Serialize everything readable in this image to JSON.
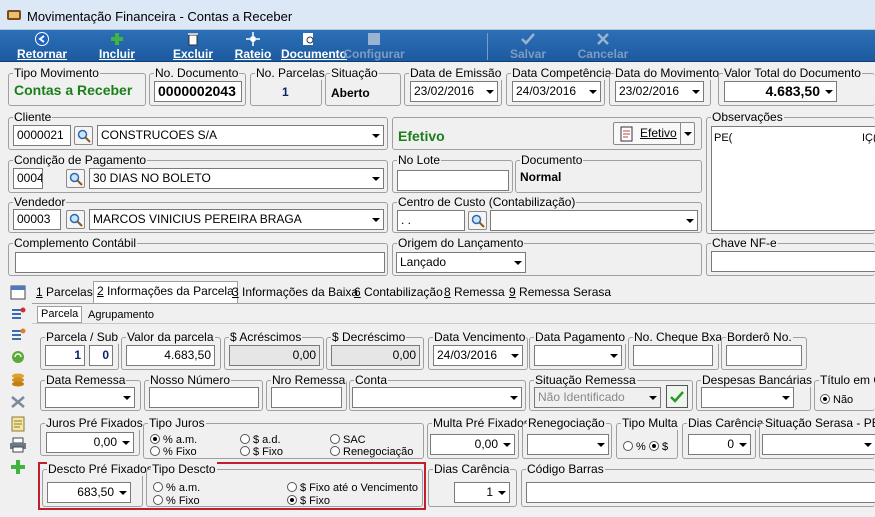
{
  "window": {
    "title": "Movimentação Financeira - Contas a Receber"
  },
  "toolbar": {
    "retornar": "Retornar",
    "incluir": "Incluir",
    "excluir": "Excluir",
    "rateio": "Rateio",
    "documento": "Documento",
    "configurar": "Configurar",
    "salvar": "Salvar",
    "cancelar": "Cancelar"
  },
  "header": {
    "tipo_movimento_label": "Tipo Movimento",
    "tipo_movimento": "Contas a Receber",
    "no_documento_label": "No. Documento",
    "no_documento": "0000002043",
    "no_parcelas_label": "No. Parcelas",
    "no_parcelas": "1",
    "situacao_label": "Situação",
    "situacao": "Aberto",
    "data_emissao_label": "Data de Emissão",
    "data_emissao": "23/02/2016",
    "data_competencia_label": "Data Competência",
    "data_competencia": "24/03/2016",
    "data_movimento_label": "Data do Movimento",
    "data_movimento": "23/02/2016",
    "valor_total_label": "Valor Total do Documento",
    "valor_total": "4.683,50"
  },
  "cliente": {
    "label": "Cliente",
    "codigo": "0000021",
    "nome": "CONSTRUCOES S/A",
    "status": "Efetivo",
    "status_button": "Efetivo"
  },
  "observacoes": {
    "label": "Observações",
    "text_left": "PE(",
    "text_right": "IÇ("
  },
  "condicao": {
    "label": "Condição de Pagamento",
    "codigo": "0004",
    "nome": "30 DIAS NO BOLETO"
  },
  "no_lote": {
    "label": "No Lote",
    "value": ""
  },
  "documento": {
    "label": "Documento",
    "value": "Normal"
  },
  "vendedor": {
    "label": "Vendedor",
    "codigo": "00003",
    "nome": "MARCOS VINICIUS PEREIRA BRAGA"
  },
  "centro_custo": {
    "label": "Centro de Custo (Contabilização)",
    "codigo": ". .",
    "nome": ""
  },
  "complemento": {
    "label": "Complemento Contábil",
    "value": ""
  },
  "origem": {
    "label": "Origem do Lançamento",
    "value": "Lançado"
  },
  "chave": {
    "label": "Chave NF-e",
    "value": ""
  },
  "tabs": [
    {
      "num": "1",
      "label": " Parcelas"
    },
    {
      "num": "2",
      "label": " Informações da Parcela"
    },
    {
      "num": "3",
      "label": " Informações da Baixa"
    },
    {
      "num": "6",
      "label": " Contabilização"
    },
    {
      "num": "8",
      "label": " Remessa"
    },
    {
      "num": "9",
      "label": " Remessa Serasa"
    }
  ],
  "subtabs": [
    "Parcela",
    "Agrupamento"
  ],
  "parcela": {
    "parcela_sub_label": "Parcela / Sub",
    "parcela": "1",
    "sub": "0",
    "valor_label": "Valor da parcela",
    "valor": "4.683,50",
    "acrescimos_label": "$ Acréscimos",
    "acrescimos": "0,00",
    "decrescimo_label": "$ Decréscimo",
    "decrescimo": "0,00",
    "data_vencimento_label": "Data Vencimento",
    "data_vencimento": "24/03/2016",
    "data_pagamento_label": "Data Pagamento",
    "data_pagamento": "",
    "cheque_label": "No. Cheque Bxa",
    "cheque": "",
    "bordero_label": "Borderô No.",
    "bordero": ""
  },
  "remessa": {
    "data_remessa_label": "Data Remessa",
    "nosso_numero_label": "Nosso Número",
    "nro_remessa_label": "Nro Remessa",
    "conta_label": "Conta",
    "situacao_label": "Situação Remessa",
    "situacao": "Não Identificado",
    "despesas_label": "Despesas Bancárias",
    "titulo_label": "Título em C",
    "titulo_opt": "Não"
  },
  "juros": {
    "label": "Juros Pré Fixados",
    "value": "0,00",
    "tipo_label": "Tipo Juros",
    "opts": [
      "% a.m.",
      "% Fixo",
      "$ a.d.",
      "$ Fixo",
      "SAC",
      "Renegociação"
    ],
    "multa_label": "Multa Pré Fixados",
    "multa": "0,00",
    "reneg_label": "Renegociação",
    "tipo_multa_label": "Tipo Multa",
    "tipo_multa_opts": [
      "%",
      "$"
    ],
    "dias_carencia_label": "Dias Carência",
    "dias_carencia": "0",
    "serasa_label": "Situação Serasa - PEF"
  },
  "desconto": {
    "label": "Descto Pré Fixados",
    "value": "683,50",
    "tipo_label": "Tipo Descto",
    "opts": [
      "% a.m.",
      "% Fixo",
      "$ Fixo até o Vencimento",
      "$ Fixo"
    ],
    "dias_label": "Dias Carência",
    "dias": "1",
    "codigo_barras_label": "Código Barras",
    "codigo_barras": ""
  },
  "colors": {
    "toolbar": "#2c70b7",
    "highlight": "#c0202a",
    "green_text": "#1a7f1a"
  }
}
